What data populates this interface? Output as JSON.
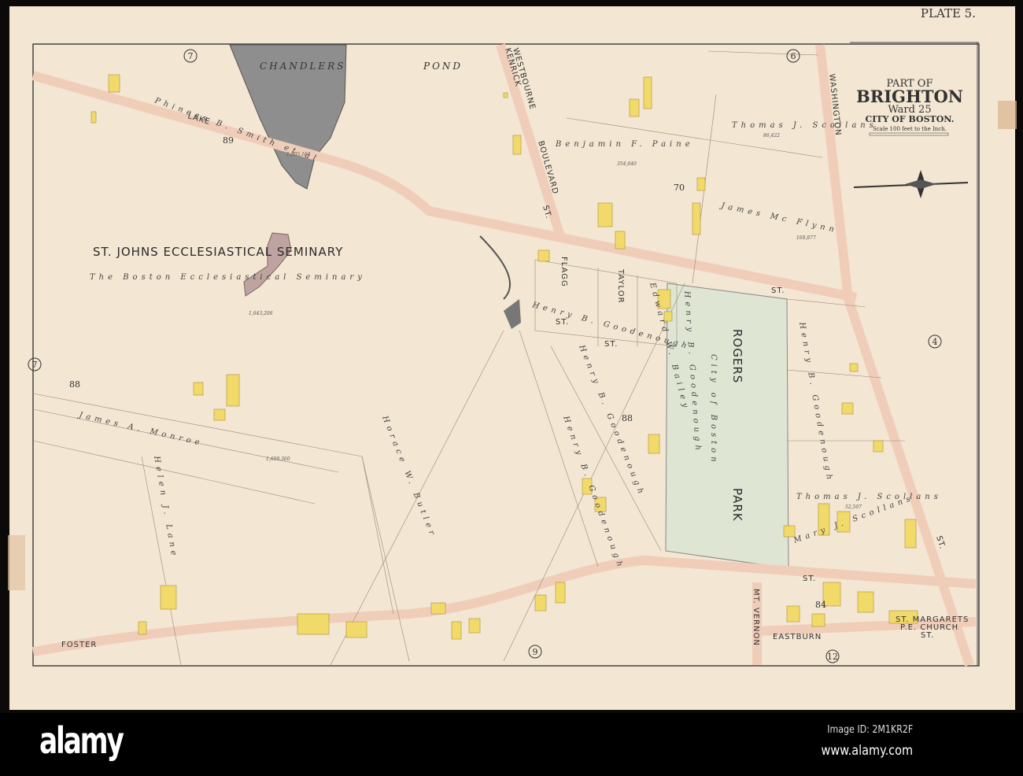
{
  "plate": "PLATE 5.",
  "title_block": {
    "line1": "PART OF",
    "line2": "BRIGHTON",
    "line3": "Ward 25",
    "line4": "CITY OF BOSTON.",
    "scale": "Scale 100 feet to the Inch."
  },
  "water": {
    "pond_word1": "CHANDLERS",
    "pond_word2": "POND"
  },
  "institutions": {
    "seminary": "ST. JOHNS ECCLESIASTICAL SEMINARY",
    "seminary_owner": "The Boston Ecclesiastical Seminary",
    "seminary_area": "1,643,206",
    "park_word1": "ROGERS",
    "park_word2": "PARK",
    "park_owner": "City of Boston",
    "church": "ST. MARGARETS",
    "church2": "P.E. CHURCH"
  },
  "streets": {
    "lake": "LAKE",
    "st": "ST.",
    "westbourne": "WESTBOURNE",
    "kenrick": "KENRICK",
    "boulevard": "BOULEVARD",
    "washington": "WASHINGTON",
    "foster": "FOSTER",
    "eastburn": "EASTBURN",
    "mt_vernon": "MT. VERNON",
    "flagg": "FLAGG",
    "taylor": "TAYLOR"
  },
  "owners": {
    "phineas": "Phineas B. Smith et al",
    "phineas_area": "1,505,164",
    "benjamin": "Benjamin F. Paine",
    "benjamin_area": "354,640",
    "scollans1": "Thomas J. Scollans",
    "scollans1_area": "86,422",
    "mcflynn": "James Mc Flynn",
    "mcflynn_area": "169,877",
    "goodenough1": "Henry B. Goodenough",
    "goodenough2": "Henry B. Goodenough",
    "goodenough3": "Henry B. Goodenough",
    "goodenough4": "Henry B. Goodenough",
    "goodenough5": "Henry B. Goodenough",
    "bailey": "Edward W. Bailey",
    "monroe": "James A. Monroe",
    "monroe_area": "1,609,360",
    "horace": "Horace W. Butler",
    "helen": "Helen J. Lane",
    "scollans2": "Thomas J. Scollans",
    "scollans2_area": "52,507",
    "mary": "Mary J. Scollans"
  },
  "ward_numbers": {
    "w7a": "7",
    "w7b": "7",
    "w6": "6",
    "w4": "4",
    "w9": "9",
    "w12": "12"
  },
  "block_numbers": {
    "b89": "89",
    "b70": "70",
    "b88a": "88",
    "b88b": "88",
    "b84": "84"
  },
  "watermark": {
    "logo": "alamy",
    "image_id": "Image ID: 2M1KR2F",
    "site": "www.alamy.com"
  },
  "colors": {
    "paper": "#f3e6d2",
    "road": "#f0cdb9",
    "building": "#f2da6a",
    "park": "#dfe5d3",
    "pond": "#8e8e8e"
  }
}
